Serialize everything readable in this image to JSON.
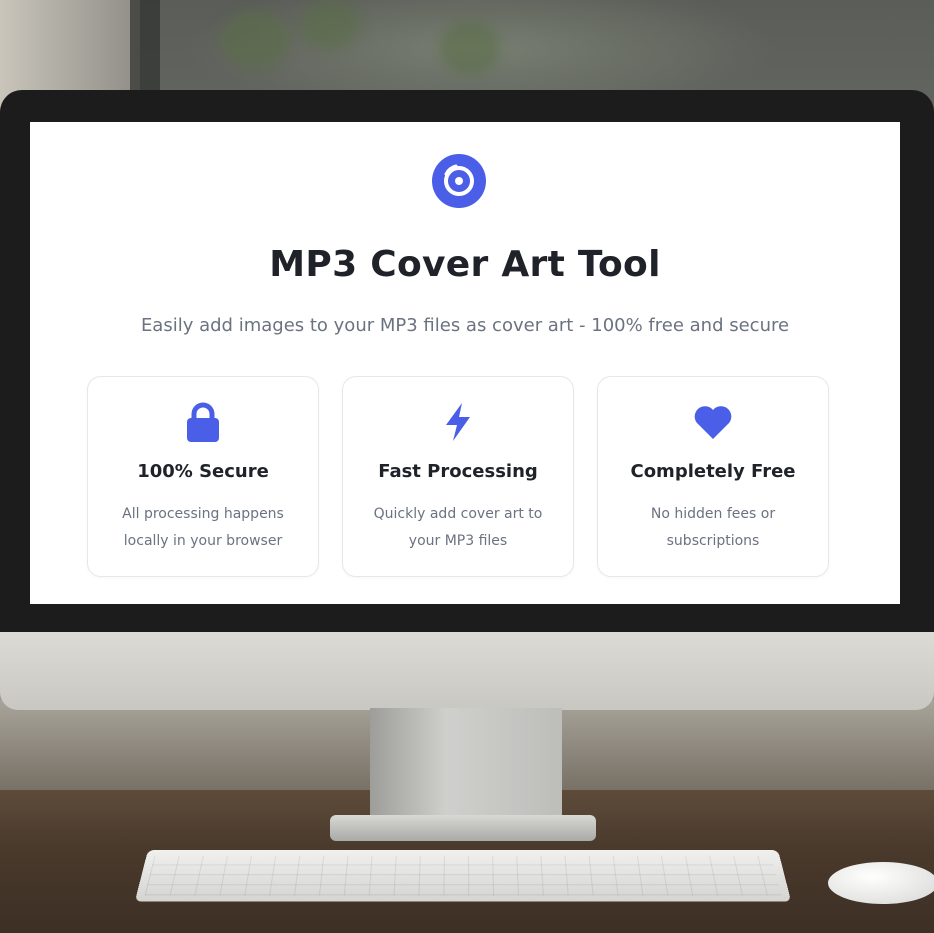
{
  "app": {
    "title": "MP3 Cover Art Tool",
    "subtitle": "Easily add images to your MP3 files as cover art - 100% free and secure",
    "logo_icon": "disc-icon",
    "accent_color": "#4a5ee8"
  },
  "features": [
    {
      "icon": "lock-icon",
      "title": "100% Secure",
      "description": "All processing happens locally in your browser"
    },
    {
      "icon": "lightning-icon",
      "title": "Fast Processing",
      "description": "Quickly add cover art to your MP3 files"
    },
    {
      "icon": "heart-icon",
      "title": "Completely Free",
      "description": "No hidden fees or subscriptions"
    }
  ]
}
